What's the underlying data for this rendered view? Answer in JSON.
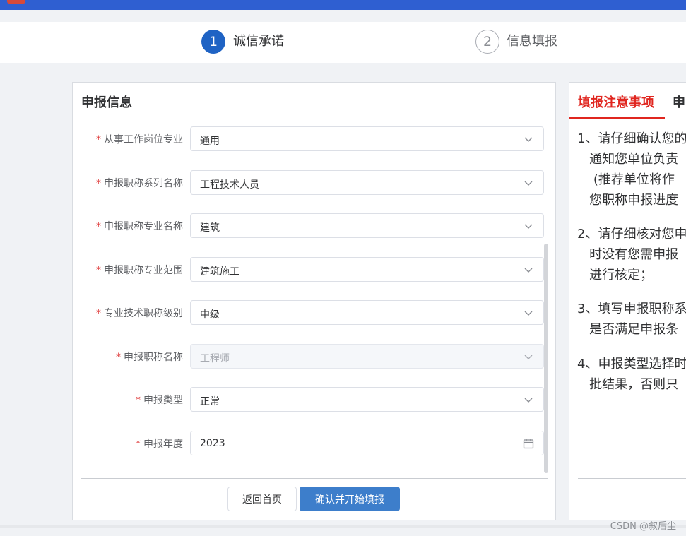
{
  "steps": [
    {
      "number": "1",
      "label": "诚信承诺",
      "state": "active"
    },
    {
      "number": "2",
      "label": "信息填报",
      "state": "todo"
    }
  ],
  "left_panel": {
    "title": "申报信息",
    "fields": [
      {
        "label": "从事工作岗位专业",
        "value": "通用"
      },
      {
        "label": "申报职称系列名称",
        "value": "工程技术人员"
      },
      {
        "label": "申报职称专业名称",
        "value": "建筑"
      },
      {
        "label": "申报职称专业范围",
        "value": "建筑施工"
      },
      {
        "label": "专业技术职称级别",
        "value": "中级"
      },
      {
        "label": "申报职称名称",
        "value": "工程师",
        "disabled": true
      },
      {
        "label": "申报类型",
        "value": "正常"
      },
      {
        "label": "申报年度",
        "value": "2023",
        "icon": "calendar-icon"
      }
    ],
    "required_mark": "*",
    "buttons": {
      "back": "返回首页",
      "confirm": "确认并开始填报"
    }
  },
  "right_panel": {
    "tabs": [
      "填报注意事项",
      "申"
    ],
    "notices": [
      "1、请仔细确认您的\n   通知您单位负责\n    (推荐单位将作\n   您职称申报进度",
      "2、请仔细核对您申\n   时没有您需申报\n   进行核定；",
      "3、填写申报职称系\n   是否满足申报条",
      "4、申报类型选择时\n   批结果，否则只"
    ]
  },
  "watermark": "CSDN @叙后尘",
  "colors": {
    "primary": "#1f63c4",
    "button": "#3d7ecb",
    "tab_active": "#e0261f",
    "header": "#2f5fd1"
  }
}
